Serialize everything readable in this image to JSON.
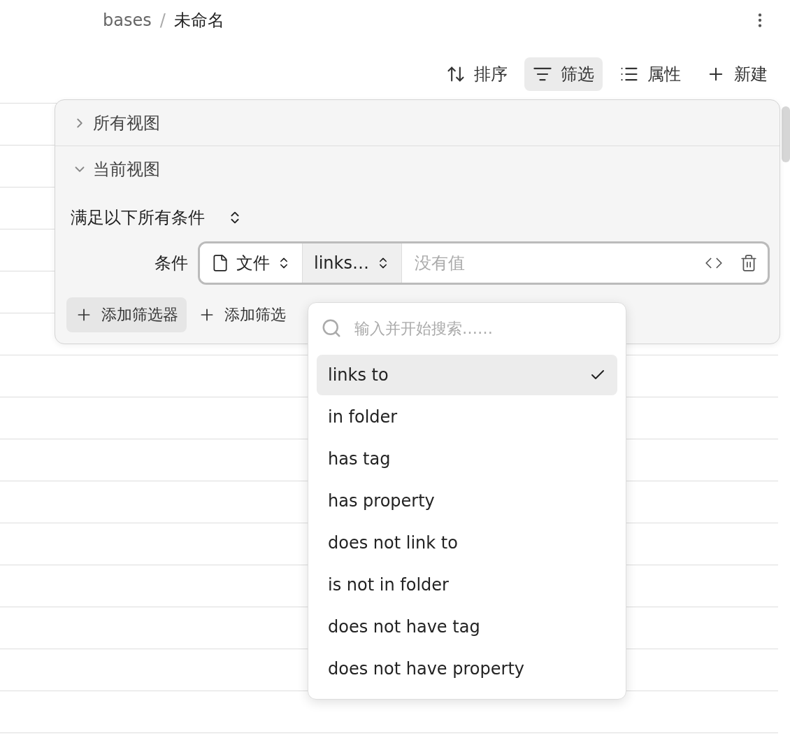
{
  "breadcrumb": {
    "parent": "bases",
    "separator": "/",
    "current": "未命名"
  },
  "toolbar": [
    {
      "kind": "sort",
      "label": "排序",
      "selected": false
    },
    {
      "kind": "filter",
      "label": "筛选",
      "selected": true
    },
    {
      "kind": "properties",
      "label": "属性",
      "selected": false
    },
    {
      "kind": "new",
      "label": "新建",
      "selected": false
    }
  ],
  "filter_panel": {
    "sections": [
      {
        "label": "所有视图",
        "expanded": false
      },
      {
        "label": "当前视图",
        "expanded": true
      }
    ],
    "conjunction": "满足以下所有条件",
    "condition": {
      "label": "条件",
      "property": "文件",
      "operator": "links…",
      "value_placeholder": "没有值"
    },
    "add_buttons": [
      {
        "label": "添加筛选器",
        "highlighted": true
      },
      {
        "label": "添加筛选",
        "highlighted": false
      }
    ]
  },
  "dropdown": {
    "search_placeholder": "输入并开始搜索……",
    "options": [
      {
        "label": "links to",
        "selected": true
      },
      {
        "label": "in folder",
        "selected": false
      },
      {
        "label": "has tag",
        "selected": false
      },
      {
        "label": "has property",
        "selected": false
      },
      {
        "label": "does not link to",
        "selected": false
      },
      {
        "label": "is not in folder",
        "selected": false
      },
      {
        "label": "does not have tag",
        "selected": false
      },
      {
        "label": "does not have property",
        "selected": false
      }
    ]
  }
}
